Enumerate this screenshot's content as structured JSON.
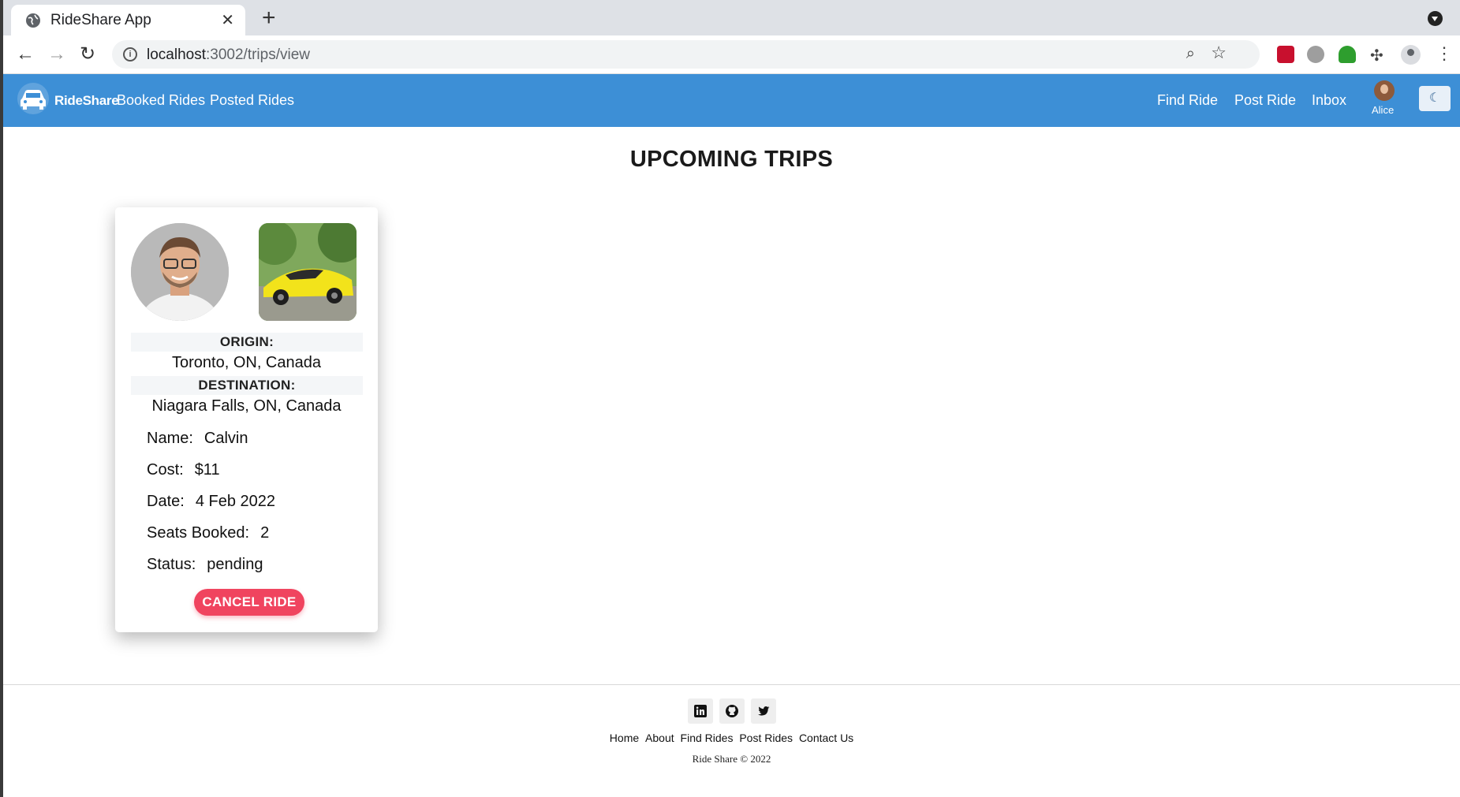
{
  "browser": {
    "tab_title": "RideShare App",
    "url_host": "localhost",
    "url_path": ":3002/trips/view"
  },
  "navbar": {
    "brand": "RideShare",
    "left_links": [
      "Booked Rides",
      "Posted Rides"
    ],
    "right_links": [
      "Find Ride",
      "Post Ride",
      "Inbox"
    ],
    "user_name": "Alice"
  },
  "page": {
    "title": "UPCOMING TRIPS"
  },
  "trip": {
    "origin_label": "ORIGIN:",
    "origin": "Toronto, ON, Canada",
    "destination_label": "DESTINATION:",
    "destination": "Niagara Falls, ON, Canada",
    "details": [
      {
        "label": "Name:",
        "value": "Calvin"
      },
      {
        "label": "Cost:",
        "value": "$11"
      },
      {
        "label": "Date:",
        "value": "4 Feb 2022"
      },
      {
        "label": "Seats Booked:",
        "value": "2"
      },
      {
        "label": "Status:",
        "value": "pending"
      }
    ],
    "cancel_label": "CANCEL RIDE"
  },
  "footer": {
    "links": [
      "Home",
      "About",
      "Find Rides",
      "Post Rides",
      "Contact Us"
    ],
    "copyright": "Ride Share © 2022"
  }
}
